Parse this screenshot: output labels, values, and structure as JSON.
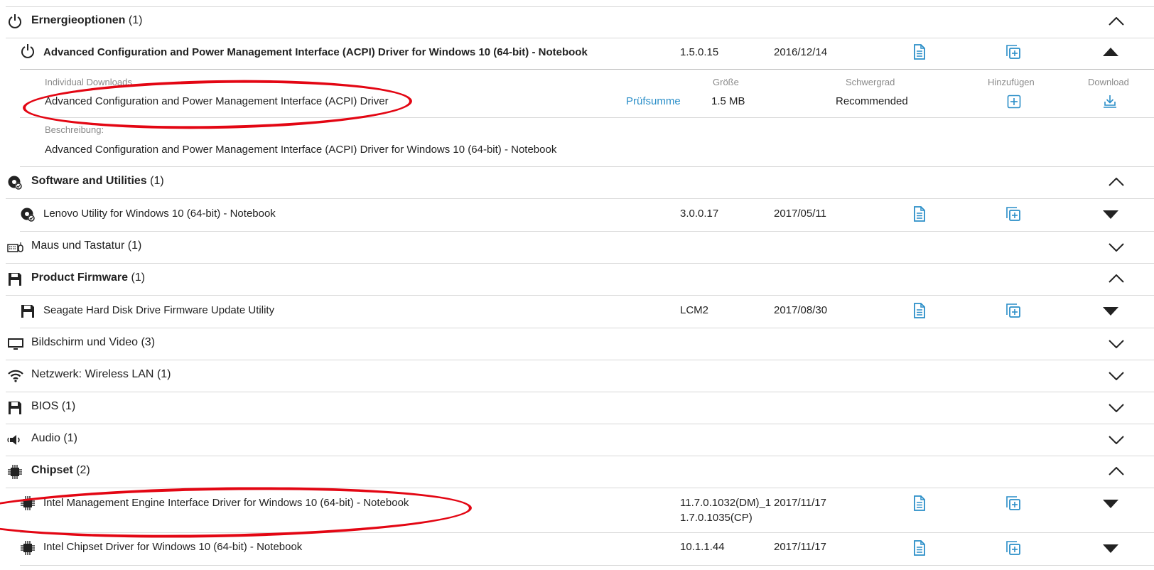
{
  "categories": {
    "power": {
      "title": "Ernergieoptionen",
      "count": "(1)"
    },
    "software": {
      "title": "Software and Utilities",
      "count": "(1)"
    },
    "mouse": {
      "title": "Maus und Tastatur",
      "count": "(1)"
    },
    "firmware": {
      "title": "Product Firmware",
      "count": "(1)"
    },
    "display": {
      "title": "Bildschirm und Video",
      "count": "(3)"
    },
    "network": {
      "title": "Netzwerk: Wireless LAN",
      "count": "(1)"
    },
    "bios": {
      "title": "BIOS",
      "count": "(1)"
    },
    "audio": {
      "title": "Audio",
      "count": "(1)"
    },
    "chipset": {
      "title": "Chipset",
      "count": "(2)"
    }
  },
  "drivers": {
    "acpi": {
      "name": "Advanced Configuration and Power Management Interface (ACPI) Driver for Windows 10 (64-bit) - Notebook",
      "version": "1.5.0.15",
      "date": "2016/12/14"
    },
    "lenovo": {
      "name": "Lenovo Utility for Windows 10 (64-bit) - Notebook",
      "version": "3.0.0.17",
      "date": "2017/05/11"
    },
    "seagate": {
      "name": "Seagate Hard Disk Drive Firmware Update Utility",
      "version": "LCM2",
      "date": "2017/08/30"
    },
    "intel_me": {
      "name": "Intel Management Engine Interface Driver for Windows 10 (64-bit) - Notebook",
      "version_line1": "11.7.0.1032(DM)_1",
      "version_line2": "1.7.0.1035(CP)",
      "date": "2017/11/17"
    },
    "intel_chipset": {
      "name": "Intel Chipset Driver for Windows 10 (64-bit) - Notebook",
      "version": "10.1.1.44",
      "date": "2017/11/17"
    }
  },
  "detail": {
    "individual_downloads_label": "Individual Downloads",
    "size_label": "Größe",
    "severity_label": "Schwergrad",
    "add_label": "Hinzufügen",
    "download_label": "Download",
    "file_name": "Advanced Configuration and Power Management Interface (ACPI) Driver",
    "checksum_link": "Prüfsumme",
    "size": "1.5 MB",
    "severity": "Recommended",
    "description_label": "Beschreibung:",
    "description": "Advanced Configuration and Power Management Interface (ACPI) Driver for Windows 10 (64-bit) - Notebook"
  },
  "colors": {
    "accent": "#2a8ec8",
    "annotation": "#e30613",
    "divider": "#d8d8d8"
  },
  "icons": [
    "power-icon",
    "disc-icon",
    "keyboard-icon",
    "floppy-icon",
    "monitor-icon",
    "wifi-icon",
    "speaker-icon",
    "chip-icon",
    "document-icon",
    "add-copy-icon",
    "chevron-up-icon",
    "chevron-down-icon",
    "triangle-up-icon",
    "triangle-down-icon",
    "plus-box-icon",
    "download-icon"
  ]
}
